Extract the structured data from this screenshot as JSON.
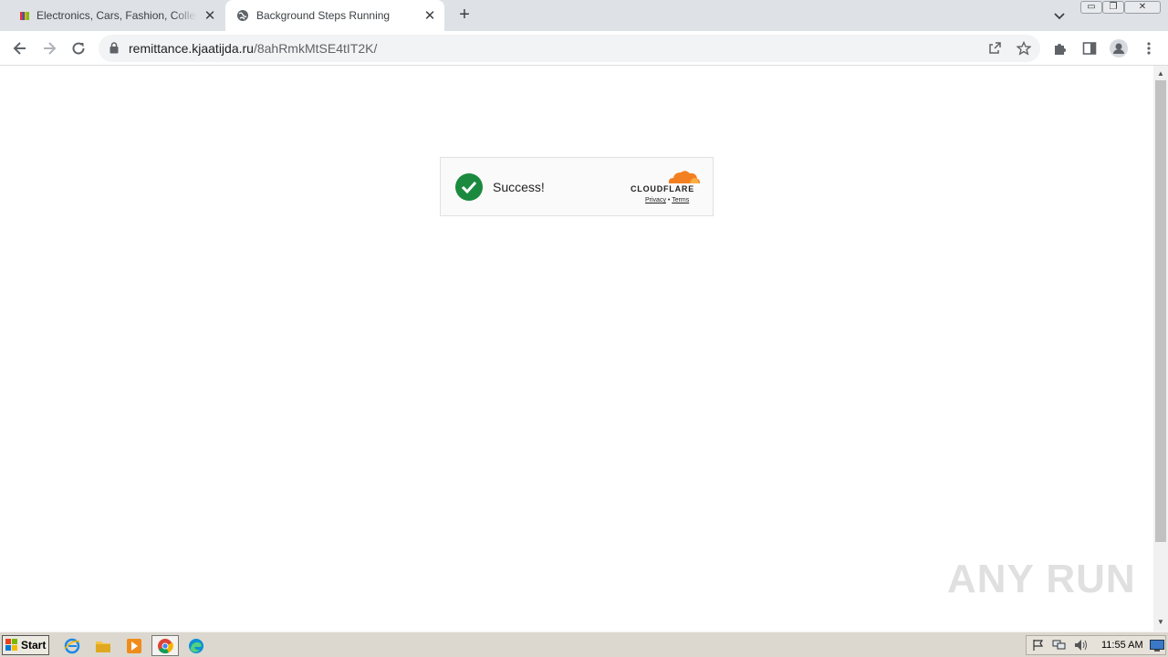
{
  "tabs": [
    {
      "title": "Electronics, Cars, Fashion, Collectibles",
      "active": false
    },
    {
      "title": "Background Steps Running",
      "active": true
    }
  ],
  "window_controls": {
    "minimize": "▭",
    "restore": "❐",
    "close": "✕"
  },
  "omnibox": {
    "host": "remittance.kjaatijda.ru",
    "path": "/8ahRmkMtSE4tIT2K/"
  },
  "widget": {
    "status": "Success!",
    "brand": "CLOUDFLARE",
    "privacy": "Privacy",
    "separator": "•",
    "terms": "Terms",
    "colors": {
      "check": "#1b8a3f",
      "cloud": "#f38020"
    }
  },
  "watermark": "ANY RUN",
  "taskbar": {
    "start_label": "Start",
    "clock": "11:55 AM"
  }
}
